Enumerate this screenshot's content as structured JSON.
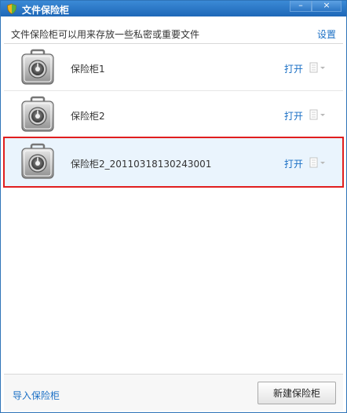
{
  "window": {
    "title": "文件保险柜",
    "minimize_label": "–",
    "close_label": "×"
  },
  "header": {
    "description": "文件保险柜可以用来存放一些私密或重要文件",
    "settings_label": "设置"
  },
  "vaults": [
    {
      "name": "保险柜1",
      "open_label": "打开",
      "selected": false
    },
    {
      "name": "保险柜2",
      "open_label": "打开",
      "selected": false
    },
    {
      "name": "保险柜2_20110318130243001",
      "open_label": "打开",
      "selected": true
    }
  ],
  "footer": {
    "import_label": "导入保险柜",
    "new_vault_label": "新建保险柜"
  },
  "colors": {
    "titlebar": "#1e67b7",
    "link": "#1a6fc5",
    "selection_outline": "#e01e1e"
  },
  "icons": {
    "app": "shield-icon",
    "vault": "safe-icon",
    "row_menu": "document-dropdown-icon"
  }
}
